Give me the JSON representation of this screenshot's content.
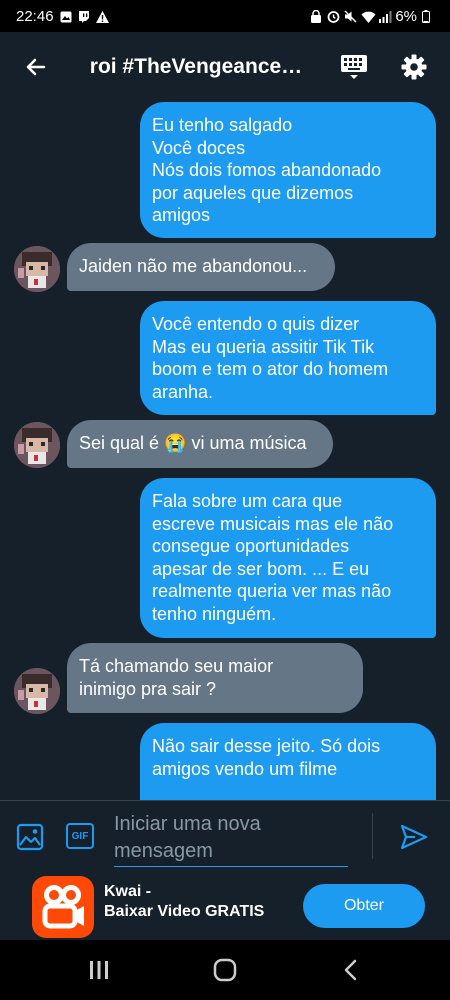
{
  "status_bar": {
    "time": "22:46",
    "battery": "6%",
    "left_icons": [
      "gallery-icon",
      "twitch-icon",
      "warning-icon"
    ],
    "right_icons": [
      "lock-icon",
      "alarm-icon",
      "mute-icon",
      "wifi-icon",
      "signal-icon",
      "battery-icon"
    ]
  },
  "header": {
    "title": "roi #TheVengeance…",
    "back_icon": "arrow-left-icon",
    "keyboard_icon": "keyboard-icon",
    "settings_icon": "gear-icon"
  },
  "messages": [
    {
      "direction": "sent",
      "lines": [
        "Eu tenho salgado",
        "Você doces",
        "Nós dois fomos abandonado",
        "por aqueles que dizemos",
        "amigos"
      ]
    },
    {
      "direction": "received",
      "lines": [
        "Jaiden não me abandonou..."
      ]
    },
    {
      "direction": "sent",
      "lines": [
        "Você entendo o quis dizer",
        "Mas eu queria assitir Tik Tik",
        "boom e tem o ator do homem",
        "aranha."
      ]
    },
    {
      "direction": "received",
      "lines": [
        "Sei qual é 😭 vi uma música"
      ]
    },
    {
      "direction": "sent",
      "lines": [
        "Fala sobre um cara que",
        "escreve musicais mas ele não",
        "consegue oportunidades",
        "apesar de ser bom. ... E eu",
        "realmente queria ver mas não",
        "tenho ninguém."
      ]
    },
    {
      "direction": "received",
      "lines": [
        "Tá chamando seu maior",
        "inimigo pra sair ?"
      ]
    },
    {
      "direction": "sent",
      "lines": [
        "Não sair  desse jeito. Só dois",
        "amigos vendo um filme"
      ]
    }
  ],
  "composer": {
    "placeholder": "Iniciar uma nova mensagem",
    "placeholder_lines": [
      "Iniciar uma nova",
      "mensagem"
    ],
    "gif_label": "GIF",
    "image_icon": "image-icon",
    "send_icon": "send-icon"
  },
  "ad": {
    "title_line1": "Kwai -",
    "title_line2": "Baixar Video GRATIS",
    "button_label": "Obter",
    "logo_icon": "kwai-logo-icon"
  },
  "nav": {
    "recents_icon": "recents-icon",
    "home_icon": "home-icon",
    "back_icon": "back-icon"
  },
  "colors": {
    "background": "#15202b",
    "sent_bubble": "#1d9bf0",
    "received_bubble": "#657786",
    "accent": "#1d9bf0",
    "ad_logo": "#ff4906"
  }
}
